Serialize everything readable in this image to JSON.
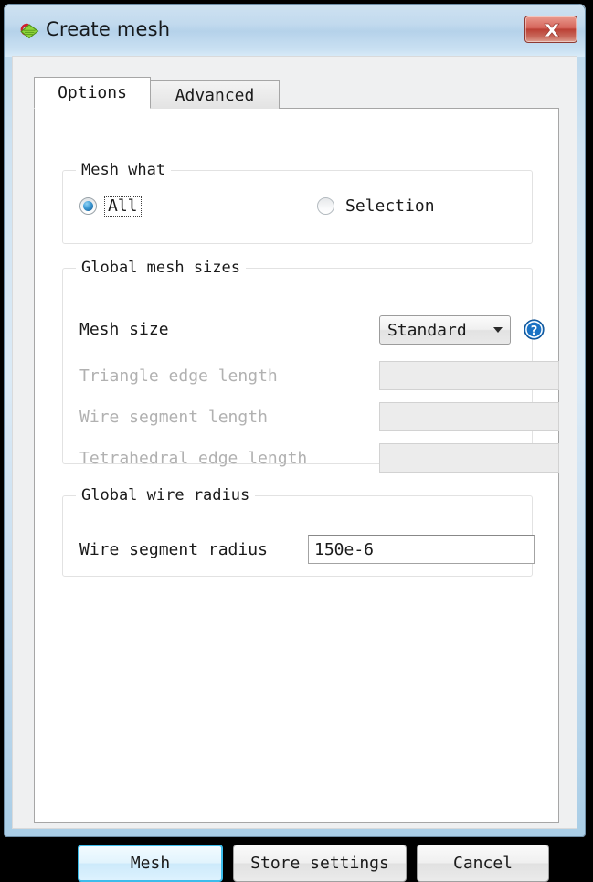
{
  "window": {
    "title": "Create mesh",
    "icon": "create-mesh-app-icon",
    "close_icon": "close-icon"
  },
  "tabs": [
    {
      "label": "Options",
      "active": true
    },
    {
      "label": "Advanced",
      "active": false
    }
  ],
  "groups": {
    "mesh_what": {
      "title": "Mesh what",
      "options": [
        {
          "label": "All",
          "selected": true,
          "focused": true
        },
        {
          "label": "Selection",
          "selected": false,
          "focused": false
        }
      ]
    },
    "global_mesh_sizes": {
      "title": "Global mesh sizes",
      "mesh_size": {
        "label": "Mesh size",
        "value": "Standard",
        "help_icon": "help-question-icon",
        "arrow_icon": "chevron-down-icon"
      },
      "fields": [
        {
          "label": "Triangle edge length",
          "value": "",
          "disabled": true
        },
        {
          "label": "Wire segment length",
          "value": "",
          "disabled": true
        },
        {
          "label": "Tetrahedral edge length",
          "value": "",
          "disabled": true
        }
      ]
    },
    "global_wire_radius": {
      "title": "Global wire radius",
      "field": {
        "label": "Wire segment radius",
        "value": "150e-6",
        "disabled": false
      }
    }
  },
  "buttons": [
    {
      "label": "Mesh",
      "style": "default"
    },
    {
      "label": "Store settings",
      "style": "normal"
    },
    {
      "label": "Cancel",
      "style": "normal"
    }
  ],
  "colors": {
    "accent": "#3cbceb",
    "titlebar": "#b5d2ea",
    "close_button": "#bb3f34",
    "radio_selected": "#3d9ad4",
    "help_icon": "#1a72c4",
    "disabled_text": "#b1b1b1"
  }
}
